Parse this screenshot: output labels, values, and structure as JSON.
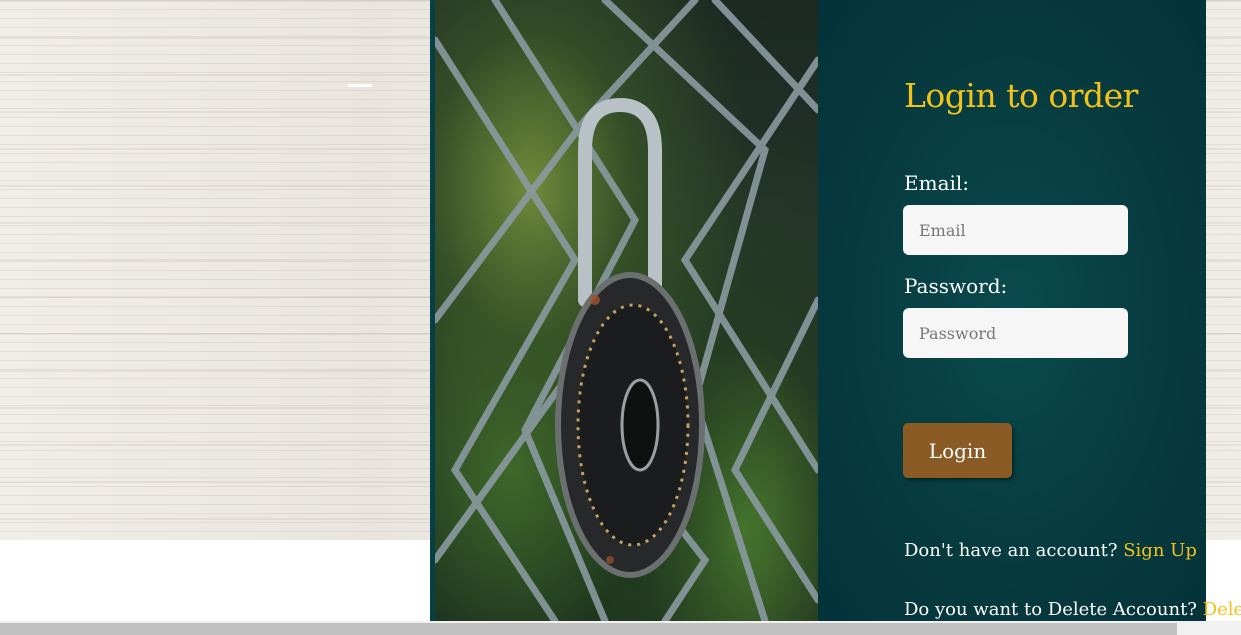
{
  "login": {
    "title": "Login to order",
    "email_label": "Email:",
    "email_placeholder": "Email",
    "password_label": "Password:",
    "password_placeholder": "Password",
    "login_button": "Login",
    "signup_prompt": "Don't have an account?",
    "signup_link": "Sign Up",
    "delete_prompt": "Do you want to Delete Account?",
    "delete_link": "Delete"
  },
  "colors": {
    "accent": "#f2c21b",
    "panel": "#063a3e",
    "button": "#8a5b24"
  },
  "image": {
    "icon": "padlock-on-chain-fence-photo"
  }
}
